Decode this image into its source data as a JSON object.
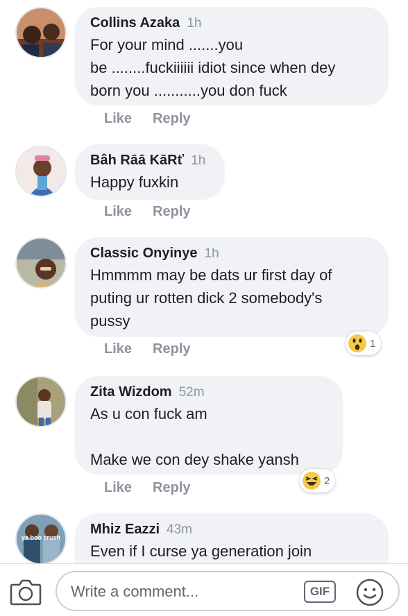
{
  "comments": [
    {
      "name": "Collins Azaka",
      "time": "1h",
      "text": "For your mind .......you\nbe ........fuckiiiiii idiot since when dey\nborn you ...........you don fuck",
      "like": "Like",
      "reply": "Reply"
    },
    {
      "name": "Bâh Rāā KāRť",
      "time": "1h",
      "text": "Happy fuxkin",
      "like": "Like",
      "reply": "Reply"
    },
    {
      "name": "Classic Onyinye",
      "time": "1h",
      "text": "Hmmmm may be dats ur first day of\nputing  ur rotten dick 2 somebody's\npussy",
      "like": "Like",
      "reply": "Reply",
      "reaction": {
        "icon": "wow-emoji-icon",
        "count": "1"
      }
    },
    {
      "name": "Zita Wizdom",
      "time": "52m",
      "text": "As u con fuck am\n\nMake we con dey shake yansh",
      "like": "Like",
      "reply": "Reply",
      "reaction": {
        "icon": "laugh-emoji-icon",
        "count": "2"
      }
    },
    {
      "name": "Mhiz Eazzi",
      "time": "43m",
      "text": "Even if I curse ya generation join",
      "avatar_caption": "ya boo crush"
    }
  ],
  "composer": {
    "placeholder": "Write a comment...",
    "gif_label": "GIF",
    "camera_icon": "camera-icon",
    "emoji_icon": "smiley-icon"
  },
  "colors": {
    "bubble": "#f0f2f5",
    "meta_text": "#8d949e",
    "body_text": "#1c1e21"
  }
}
